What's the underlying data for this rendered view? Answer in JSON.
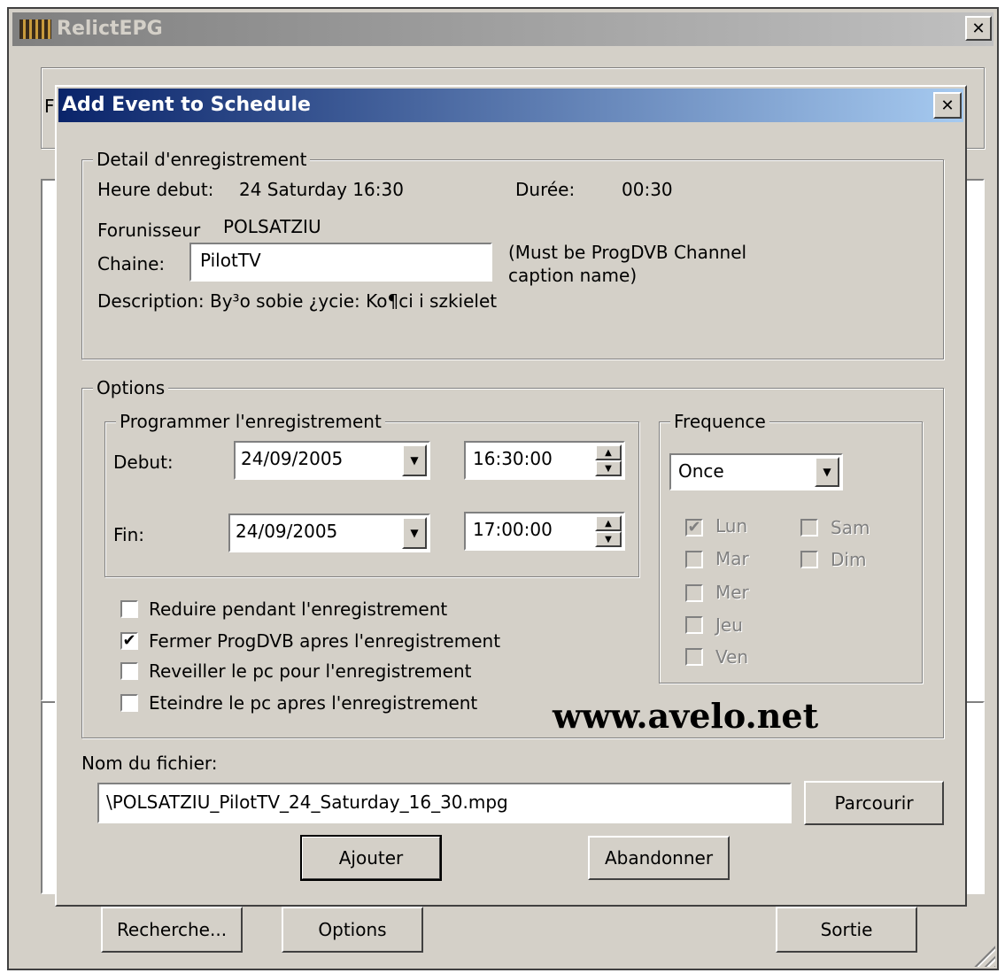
{
  "app": {
    "title": "RelictEPG",
    "left_label_fragment": "F",
    "buttons": {
      "recherche": "Recherche...",
      "options": "Options",
      "sortie": "Sortie"
    }
  },
  "dialog": {
    "title": "Add Event to Schedule",
    "detail": {
      "legend": "Detail d'enregistrement",
      "heure_debut_label": "Heure debut:",
      "heure_debut_value": "24 Saturday 16:30",
      "duree_label": "Durée:",
      "duree_value": "00:30",
      "fournisseur_label": "Forunisseur",
      "fournisseur_value": "POLSATZIU",
      "chaine_label": "Chaine:",
      "chaine_value": "PilotTV",
      "chaine_note": "(Must be ProgDVB Channel caption name)",
      "description": "Description: By³o sobie ¿ycie: Ko¶ci i szkielet"
    },
    "options": {
      "legend": "Options",
      "programmer": {
        "legend": "Programmer l'enregistrement",
        "debut_label": "Debut:",
        "debut_date": "24/09/2005",
        "debut_time": "16:30:00",
        "fin_label": "Fin:",
        "fin_date": "24/09/2005",
        "fin_time": "17:00:00"
      },
      "frequence": {
        "legend": "Frequence",
        "selected": "Once",
        "days": [
          {
            "label": "Lun",
            "checked": true
          },
          {
            "label": "Mar",
            "checked": false
          },
          {
            "label": "Mer",
            "checked": false
          },
          {
            "label": "Jeu",
            "checked": false
          },
          {
            "label": "Ven",
            "checked": false
          },
          {
            "label": "Sam",
            "checked": false
          },
          {
            "label": "Dim",
            "checked": false
          }
        ]
      },
      "checkboxes": [
        {
          "label": "Reduire pendant l'enregistrement",
          "checked": false
        },
        {
          "label": "Fermer ProgDVB apres l'enregistrement",
          "checked": true
        },
        {
          "label": "Reveiller le pc pour  l'enregistrement",
          "checked": false
        },
        {
          "label": "Eteindre le pc apres l'enregistrement",
          "checked": false
        }
      ]
    },
    "watermark": "www.avelo.net",
    "filename_label": "Nom du fichier:",
    "filename_value": "\\POLSATZIU_PilotTV_24_Saturday_16_30.mpg",
    "browse_button": "Parcourir",
    "add_button": "Ajouter",
    "cancel_button": "Abandonner"
  },
  "colors": {
    "face": "#d4d0c8",
    "title_active_start": "#0a246a",
    "title_active_end": "#a6caf0",
    "title_inactive": "#808080"
  }
}
